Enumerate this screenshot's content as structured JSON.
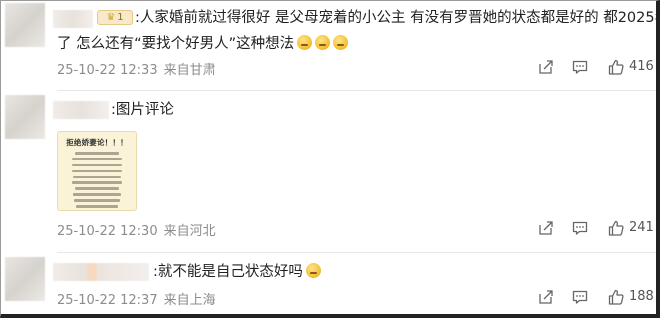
{
  "comments": [
    {
      "badge": "1",
      "text_line1": ":人家婚前就过得很好 是父母宠着的小公主 有没有罗晋她的状态都是好的 都2025年",
      "text_line2": "了 怎么还有“要找个好男人”这种想法",
      "emoji_count": 3,
      "date": "25-10-22 12:33",
      "location": "来自甘肃",
      "likes": "416"
    },
    {
      "text_line1": ":图片评论",
      "image": {
        "title": "拒绝娇妻论！！！",
        "line_count": 11
      },
      "date": "25-10-22 12:30",
      "location": "来自河北",
      "likes": "241"
    },
    {
      "text_line1": ":就不能是自己状态好吗",
      "emoji_count": 1,
      "date": "25-10-22 12:37",
      "location": "来自上海",
      "likes": "188"
    }
  ],
  "icons": {
    "share": "share-icon",
    "comment": "comment-icon",
    "like": "thumbs-up-icon"
  }
}
